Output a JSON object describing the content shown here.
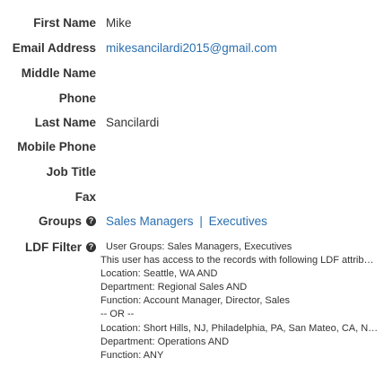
{
  "fields": {
    "first_name": {
      "label": "First Name",
      "value": "Mike"
    },
    "email_address": {
      "label": "Email Address",
      "value": "mikesancilardi2015@gmail.com"
    },
    "middle_name": {
      "label": "Middle Name",
      "value": ""
    },
    "phone": {
      "label": "Phone",
      "value": ""
    },
    "last_name": {
      "label": "Last Name",
      "value": "Sancilardi"
    },
    "mobile_phone": {
      "label": "Mobile Phone",
      "value": ""
    },
    "job_title": {
      "label": "Job Title",
      "value": ""
    },
    "fax": {
      "label": "Fax",
      "value": ""
    }
  },
  "groups": {
    "label": "Groups",
    "help_icon": "question-circle-icon",
    "items": [
      "Sales Managers",
      "Executives"
    ],
    "separator": "|"
  },
  "ldf_filter": {
    "label": "LDF Filter",
    "help_icon": "question-circle-icon",
    "lines": [
      "User Groups: Sales Managers, Executives",
      "This user has access to the records with following LDF attributes:",
      "Location: Seattle, WA AND",
      "Department: Regional Sales AND",
      "Function: Account Manager, Director, Sales",
      "-- OR --",
      "Location: Short Hills, NJ, Philadelphia, PA, San Mateo, CA, New York, NY",
      "Department: Operations AND",
      "Function: ANY"
    ]
  },
  "colors": {
    "link": "#2a6fb0",
    "text": "#333333"
  }
}
